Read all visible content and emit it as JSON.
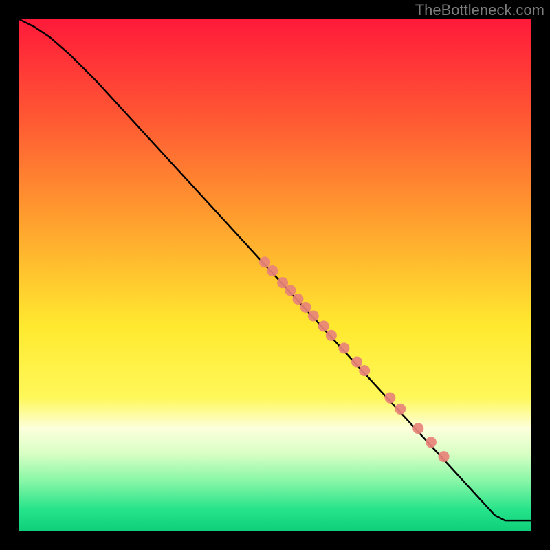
{
  "watermark": "TheBottleneck.com",
  "chart_data": {
    "type": "line",
    "title": "",
    "xlabel": "",
    "ylabel": "",
    "xlim": [
      0,
      100
    ],
    "ylim": [
      0,
      100
    ],
    "gradient_stops": [
      {
        "offset": 0,
        "color": "#ff1a3a"
      },
      {
        "offset": 20,
        "color": "#ff5a33"
      },
      {
        "offset": 40,
        "color": "#ffa22e"
      },
      {
        "offset": 60,
        "color": "#ffe92f"
      },
      {
        "offset": 74,
        "color": "#fff85a"
      },
      {
        "offset": 80,
        "color": "#fcffdc"
      },
      {
        "offset": 85,
        "color": "#d7ffc4"
      },
      {
        "offset": 90,
        "color": "#8cf7a8"
      },
      {
        "offset": 96,
        "color": "#24e38a"
      },
      {
        "offset": 100,
        "color": "#0fcf7a"
      }
    ],
    "series": [
      {
        "name": "curve",
        "type": "line",
        "color": "#000000",
        "points": [
          {
            "x": 0.0,
            "y": 100.0
          },
          {
            "x": 3.0,
            "y": 98.5
          },
          {
            "x": 6.0,
            "y": 96.5
          },
          {
            "x": 10.0,
            "y": 93.0
          },
          {
            "x": 15.0,
            "y": 88.0
          },
          {
            "x": 93.0,
            "y": 3.0
          },
          {
            "x": 95.0,
            "y": 2.0
          },
          {
            "x": 100.0,
            "y": 2.0
          }
        ]
      },
      {
        "name": "markers",
        "type": "scatter",
        "color": "#e88379",
        "points": [
          {
            "x": 48.0,
            "y": 52.5
          },
          {
            "x": 49.5,
            "y": 50.8
          },
          {
            "x": 51.5,
            "y": 48.5
          },
          {
            "x": 53.0,
            "y": 47.0
          },
          {
            "x": 54.5,
            "y": 45.3
          },
          {
            "x": 56.0,
            "y": 43.7
          },
          {
            "x": 57.5,
            "y": 42.0
          },
          {
            "x": 59.5,
            "y": 40.0
          },
          {
            "x": 61.0,
            "y": 38.2
          },
          {
            "x": 63.5,
            "y": 35.7
          },
          {
            "x": 66.0,
            "y": 33.0
          },
          {
            "x": 67.5,
            "y": 31.3
          },
          {
            "x": 72.5,
            "y": 26.0
          },
          {
            "x": 74.5,
            "y": 23.8
          },
          {
            "x": 78.0,
            "y": 20.0
          },
          {
            "x": 80.5,
            "y": 17.3
          },
          {
            "x": 83.0,
            "y": 14.5
          }
        ]
      }
    ]
  }
}
